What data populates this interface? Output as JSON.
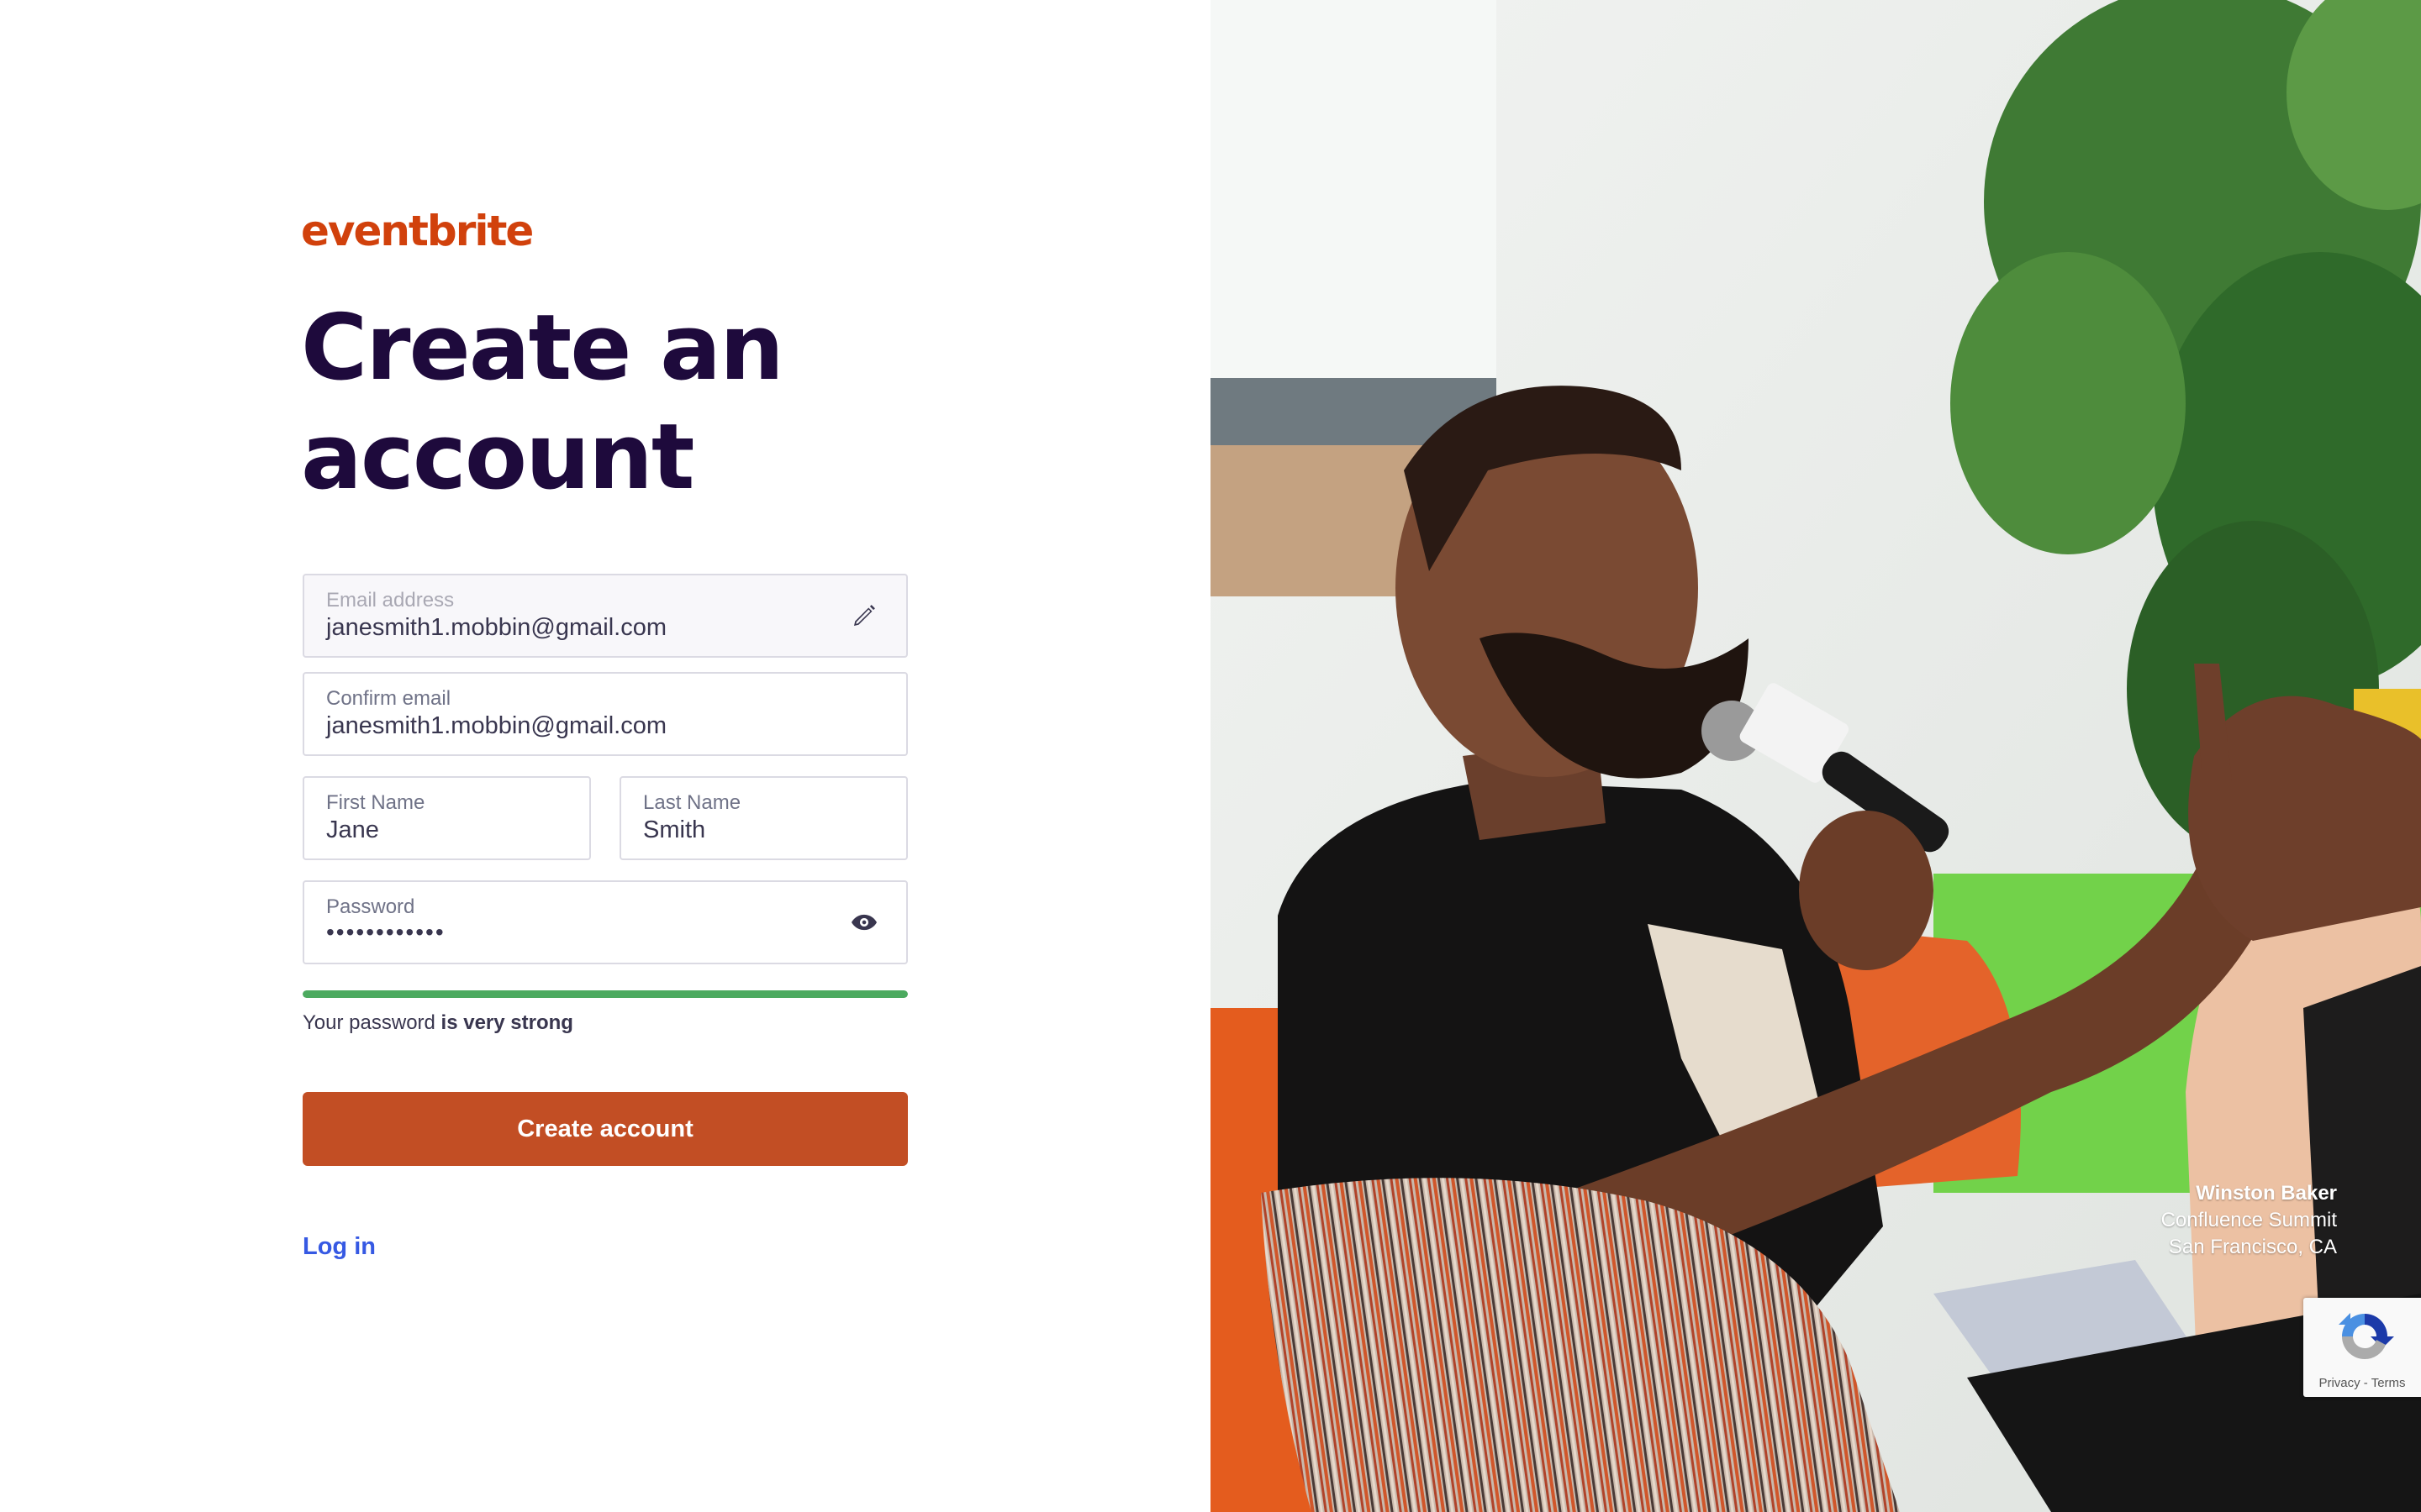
{
  "brand": {
    "logo_text": "eventbrite",
    "logo_color": "#d1410c"
  },
  "page": {
    "title": "Create an account"
  },
  "form": {
    "email": {
      "label": "Email address",
      "value": "janesmith1.mobbin@gmail.com",
      "icon": "pencil-icon"
    },
    "confirm_email": {
      "label": "Confirm email",
      "value": "janesmith1.mobbin@gmail.com"
    },
    "first_name": {
      "label": "First Name",
      "value": "Jane"
    },
    "last_name": {
      "label": "Last Name",
      "value": "Smith"
    },
    "password": {
      "label": "Password",
      "value_masked": "••••••••••••",
      "icon": "eye-icon"
    },
    "password_strength": {
      "fraction": 1.0,
      "color": "#4caa5f",
      "text_prefix": "Your password ",
      "text_strength": "is very strong"
    },
    "submit_label": "Create account",
    "submit_color": "#c24e24",
    "login_label": "Log in",
    "login_color": "#3659e3"
  },
  "photo": {
    "caption_name": "Winston Baker",
    "caption_event": "Confluence Summit",
    "caption_location": "San Francisco, CA"
  },
  "recaptcha": {
    "icon": "recaptcha-icon",
    "privacy_label": "Privacy",
    "separator": " - ",
    "terms_label": "Terms"
  }
}
